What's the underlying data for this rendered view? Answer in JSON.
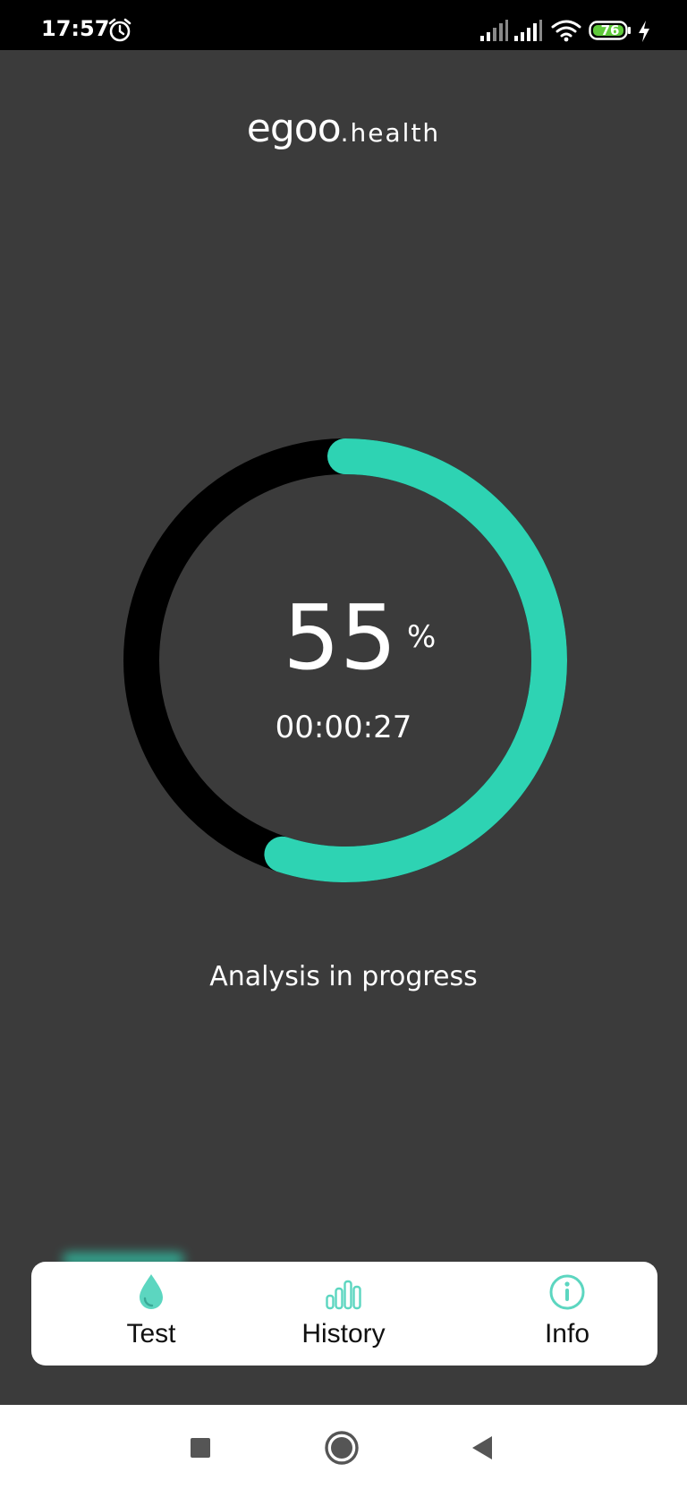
{
  "status_bar": {
    "time": "17:57",
    "battery_level": "76",
    "icons": [
      "alarm-icon",
      "signal-icon",
      "signal-icon",
      "wifi-icon",
      "battery-icon",
      "charging-bolt-icon"
    ]
  },
  "logo": {
    "main": "egoo",
    "sub": ".health"
  },
  "progress": {
    "percent_value": "55",
    "percent_sign": "%",
    "fraction": 0.55,
    "elapsed": "00:00:27",
    "message": "Analysis in progress"
  },
  "colors": {
    "background": "#3b3b3b",
    "accent": "#2ed3b3",
    "ring_track": "#000000",
    "nav_background": "#ffffff"
  },
  "bottom_nav": {
    "active": "Test",
    "items": [
      {
        "label": "Test",
        "icon": "drop-icon"
      },
      {
        "label": "History",
        "icon": "bar-chart-icon"
      },
      {
        "label": "Info",
        "icon": "info-icon"
      }
    ]
  },
  "system_nav": {
    "buttons": [
      "recents-square-icon",
      "home-circle-icon",
      "back-triangle-icon"
    ]
  }
}
